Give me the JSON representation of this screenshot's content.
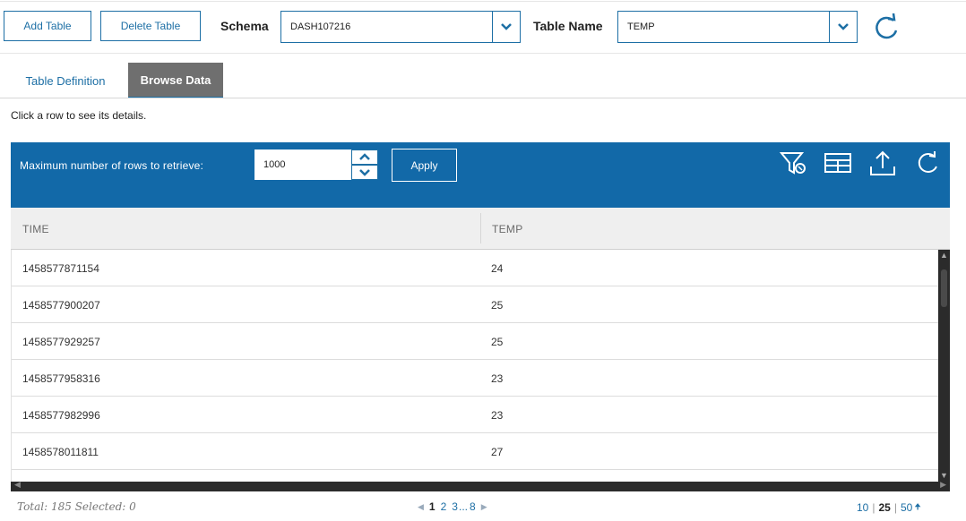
{
  "toolbar": {
    "add_table": "Add Table",
    "delete_table": "Delete Table",
    "schema_label": "Schema",
    "schema_value": "DASH107216",
    "table_name_label": "Table Name",
    "table_name_value": "TEMP",
    "refresh_icon": "refresh-icon"
  },
  "tabs": [
    {
      "label": "Table Definition",
      "active": false
    },
    {
      "label": "Browse Data",
      "active": true
    }
  ],
  "hint": "Click a row to see its details.",
  "grid": {
    "max_rows_label": "Maximum number of rows to retrieve:",
    "max_rows_value": "1000",
    "apply_label": "Apply",
    "icons": [
      "filter-icon",
      "columns-icon",
      "export-icon",
      "refresh-icon"
    ],
    "columns": [
      "TIME",
      "TEMP"
    ],
    "rows": [
      [
        "1458577871154",
        "24"
      ],
      [
        "1458577900207",
        "25"
      ],
      [
        "1458577929257",
        "25"
      ],
      [
        "1458577958316",
        "23"
      ],
      [
        "1458577982996",
        "23"
      ],
      [
        "1458578011811",
        "27"
      ],
      [
        "",
        ""
      ]
    ]
  },
  "footer": {
    "total_text": "Total: 185 Selected: 0",
    "pages": [
      "1",
      "2",
      "3",
      "...",
      "8"
    ],
    "current_page": "1",
    "page_sizes": [
      "10",
      "25",
      "50"
    ],
    "current_page_size": "25"
  },
  "colors": {
    "accent": "#1d6fa5",
    "grid_header": "#1269a8",
    "active_tab": "#6f6f6f"
  }
}
